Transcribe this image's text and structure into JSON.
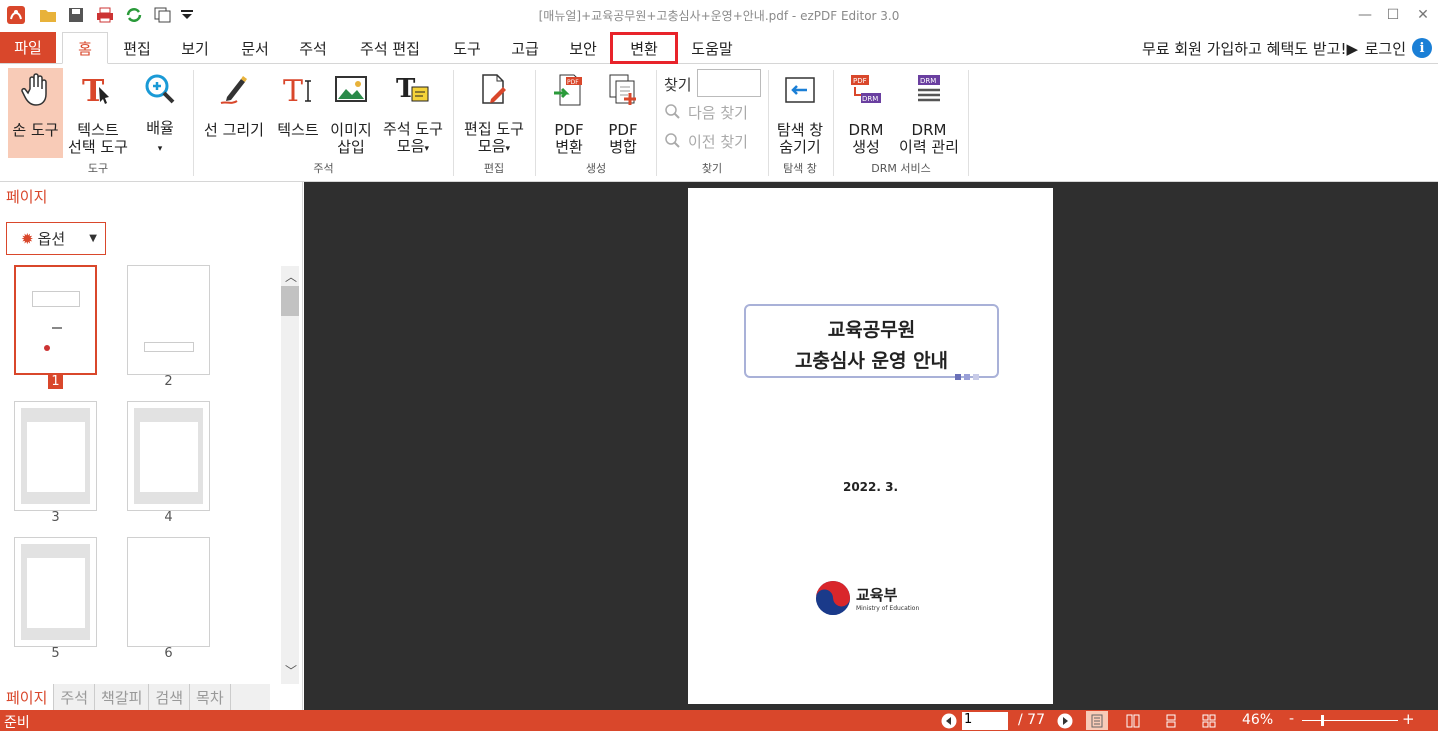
{
  "window": {
    "title": "[매뉴얼]+교육공무원+고충심사+운영+안내.pdf - ezPDF Editor 3.0"
  },
  "menu": {
    "file": "파일",
    "tabs": [
      "홈",
      "편집",
      "보기",
      "문서",
      "주석",
      "주석 편집",
      "도구",
      "고급",
      "보안",
      "변환",
      "도움말"
    ],
    "promo": "무료 회원 가입하고 혜택도 받고!▶",
    "login": "로그인"
  },
  "ribbon": {
    "hand_tool": "손 도구",
    "text_select_1": "텍스트",
    "text_select_2": "선택 도구",
    "arrange": "배율",
    "group_tool": "도구",
    "line_draw": "선 그리기",
    "text": "텍스트",
    "image_1": "이미지",
    "image_2": "삽입",
    "annot_tools_1": "주석 도구",
    "annot_tools_2": "모음",
    "group_annot": "주석",
    "edit_tools_1": "편집 도구",
    "edit_tools_2": "모음",
    "group_edit": "편집",
    "pdf_convert_1": "PDF",
    "pdf_convert_2": "변환",
    "pdf_merge_1": "PDF",
    "pdf_merge_2": "병합",
    "group_create": "생성",
    "find_label": "찾기",
    "find_next": "다음 찾기",
    "find_prev": "이전 찾기",
    "group_find": "찾기",
    "nav_hide_1": "탐색 창",
    "nav_hide_2": "숨기기",
    "group_nav": "탐색 창",
    "drm_create_1": "DRM",
    "drm_create_2": "생성",
    "drm_history_1": "DRM",
    "drm_history_2": "이력 관리",
    "group_drm": "DRM 서비스"
  },
  "left_panel": {
    "title": "페이지",
    "options": "옵션",
    "pages": [
      "1",
      "2",
      "3",
      "4",
      "5",
      "6"
    ],
    "bottom_tabs": [
      "페이지",
      "주석",
      "책갈피",
      "검색",
      "목차"
    ]
  },
  "document": {
    "title_line1": "교육공무원",
    "title_line2": "고충심사 운영 안내",
    "date": "2022. 3.",
    "org_kr": "교육부",
    "org_en": "Ministry of Education"
  },
  "status": {
    "ready": "준비",
    "current_page": "1",
    "total_pages": "/ 77",
    "zoom": "46%"
  },
  "colors": {
    "accent": "#d9472b",
    "selected": "#f8cbb7",
    "highlight": "#e8232a"
  }
}
